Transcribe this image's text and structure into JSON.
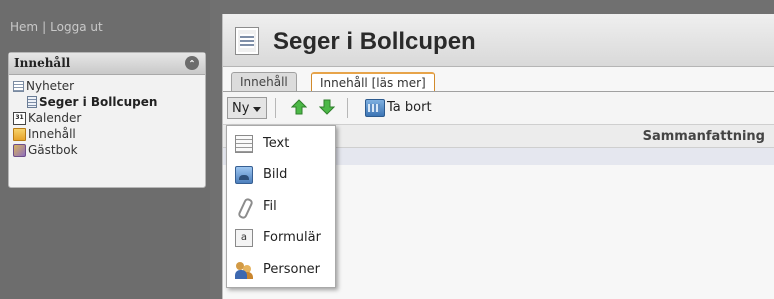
{
  "top_links": {
    "home": "Hem",
    "separator": "|",
    "logout": "Logga ut"
  },
  "nav": {
    "header": "Innehåll",
    "items": [
      {
        "label": "Nyheter",
        "icon": "news-icon"
      },
      {
        "label": "Seger i Bollcupen",
        "icon": "document-icon",
        "selected": true
      },
      {
        "label": "Kalender",
        "icon": "calendar-icon",
        "icon_text": "31"
      },
      {
        "label": "Innehåll",
        "icon": "folder-icon"
      },
      {
        "label": "Gästbok",
        "icon": "guestbook-icon"
      }
    ]
  },
  "page": {
    "title": "Seger i Bollcupen"
  },
  "tabs": [
    {
      "label": "Innehåll",
      "active": false
    },
    {
      "label": "Innehåll [läs mer]",
      "active": true
    }
  ],
  "toolbar": {
    "new_label": "Ny",
    "delete_label": "Ta bort"
  },
  "table": {
    "columns": [
      "Sammanfattning"
    ]
  },
  "new_menu": {
    "items": [
      {
        "label": "Text",
        "icon": "text-icon"
      },
      {
        "label": "Bild",
        "icon": "image-icon"
      },
      {
        "label": "Fil",
        "icon": "paperclip-icon"
      },
      {
        "label": "Formulär",
        "icon": "form-icon",
        "icon_text": "a"
      },
      {
        "label": "Personer",
        "icon": "people-icon"
      }
    ]
  },
  "colors": {
    "sidebar_bg": "#6d6d6d",
    "active_tab_accent": "#e7a44a",
    "up_arrow": "#3fae3a",
    "down_arrow": "#3fae3a"
  }
}
